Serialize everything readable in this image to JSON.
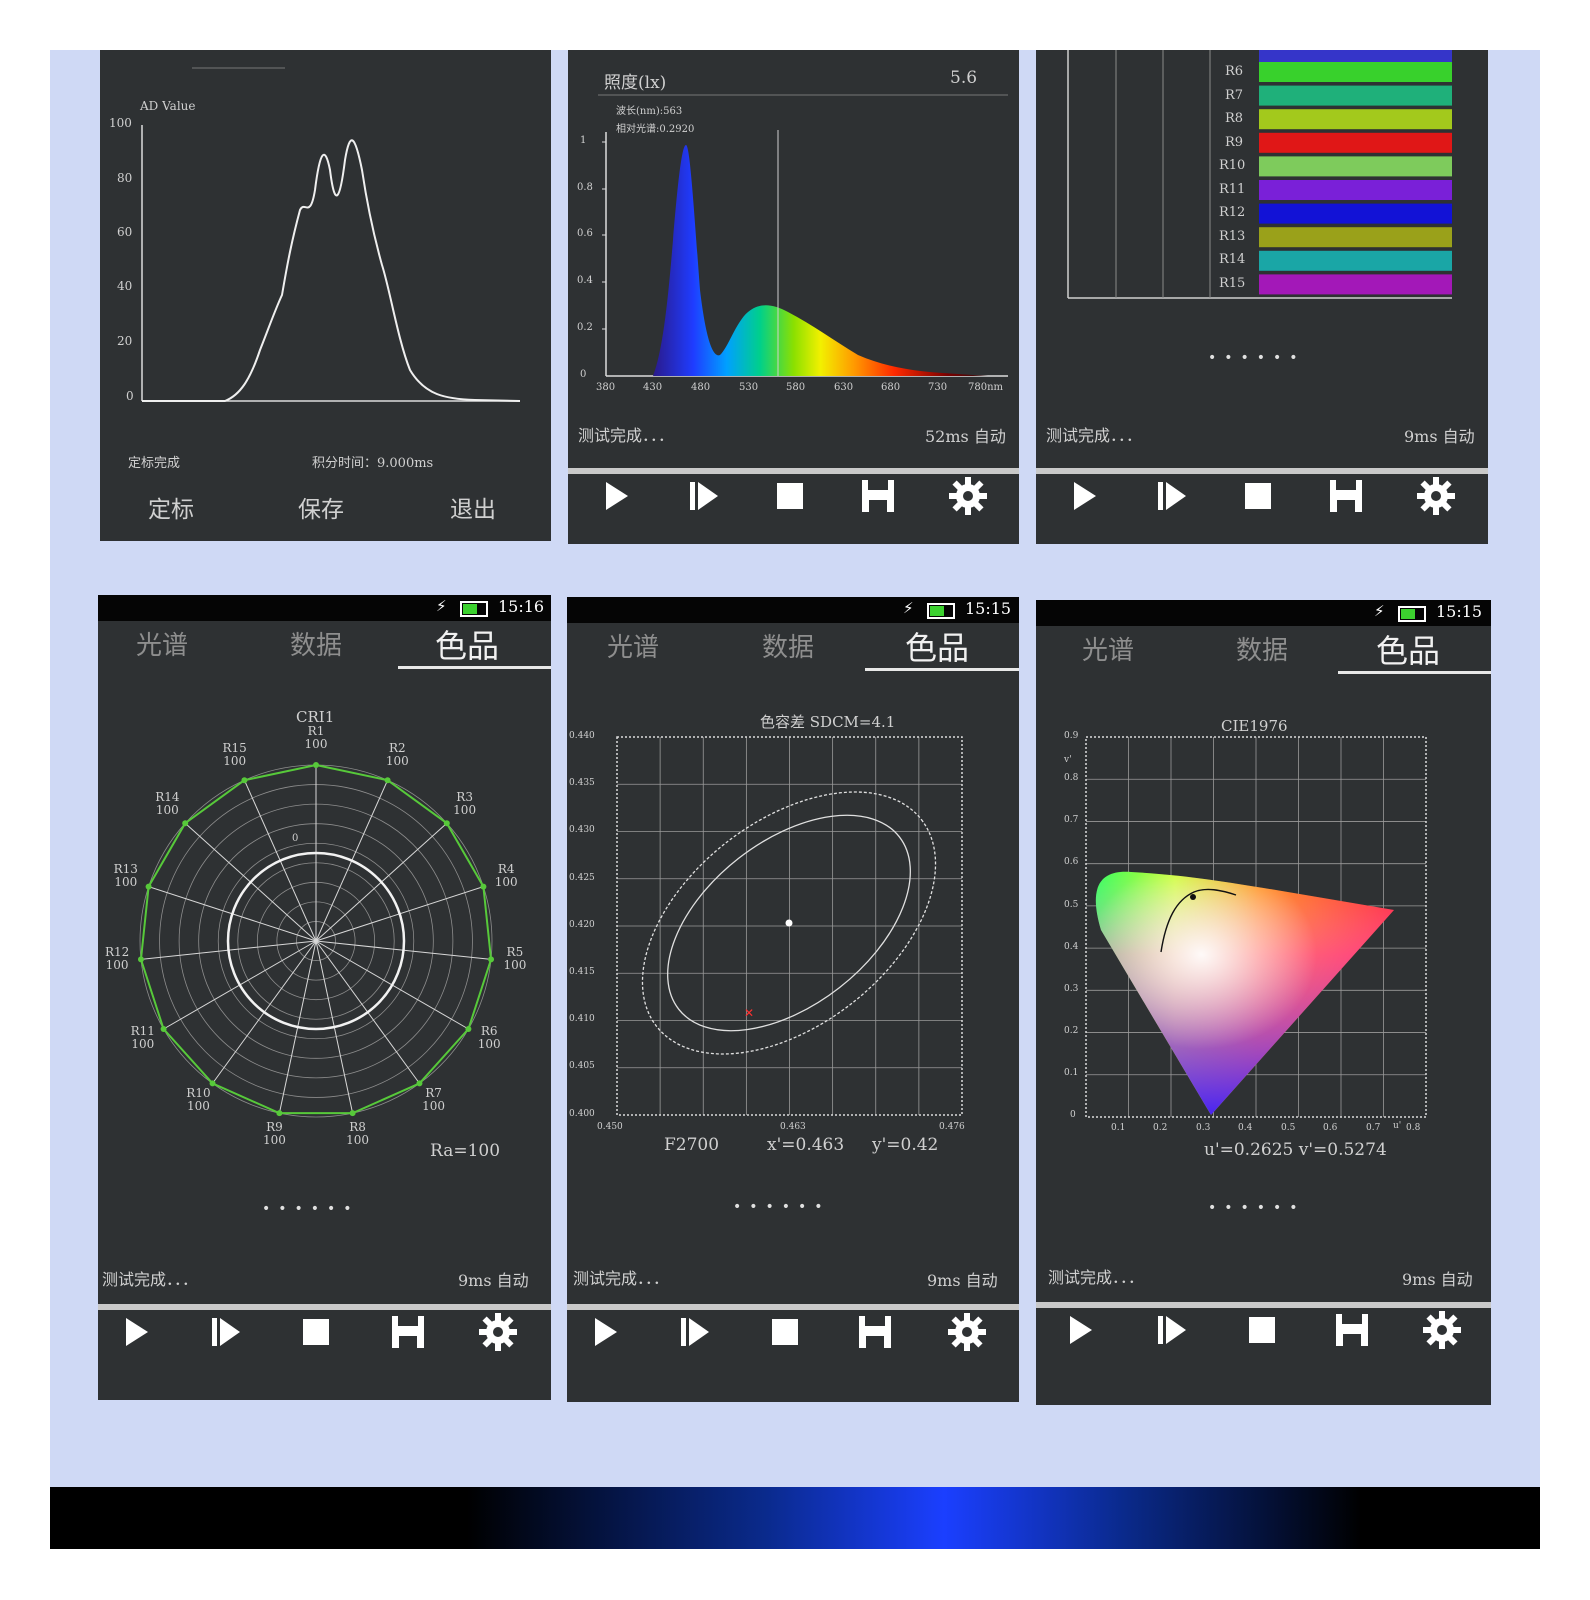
{
  "panels": {
    "p1": {
      "ylabel": "AD Value",
      "yticks": [
        "100",
        "80",
        "60",
        "40",
        "20",
        "0"
      ],
      "status": "定标完成",
      "integration": "积分时间：9.000ms",
      "buttons": [
        "定标",
        "保存",
        "退出"
      ]
    },
    "p2": {
      "lux_label": "照度(lx)",
      "lux_value": "5.6",
      "wavelength": "波长(nm):563",
      "relative": "相对光谱:0.2920",
      "yticks": [
        "1",
        "0.8",
        "0.6",
        "0.4",
        "0.2",
        "0"
      ],
      "xticks": [
        "380",
        "430",
        "480",
        "530",
        "580",
        "630",
        "680",
        "730",
        "780nm"
      ],
      "status": "测试完成．．．",
      "mode": "52ms 自动"
    },
    "p3": {
      "bar_labels": [
        "R6",
        "R7",
        "R8",
        "R9",
        "R10",
        "R11",
        "R12",
        "R13",
        "R14",
        "R15"
      ],
      "bar_colors": [
        "#38d12c",
        "#1fb07a",
        "#a3c91c",
        "#e01717",
        "#7ecb5c",
        "#7a20d8",
        "#1212d6",
        "#9aa11a",
        "#1aa6a6",
        "#a318b8"
      ],
      "status": "测试完成．．．",
      "mode": "9ms 自动"
    },
    "p4": {
      "time": "15:16",
      "tabs": [
        "光谱",
        "数据",
        "色品"
      ],
      "title": "CRI1",
      "center_label": "0",
      "r_labels": [
        {
          "n": "R1",
          "v": "100"
        },
        {
          "n": "R2",
          "v": "100"
        },
        {
          "n": "R3",
          "v": "100"
        },
        {
          "n": "R4",
          "v": "100"
        },
        {
          "n": "R5",
          "v": "100"
        },
        {
          "n": "R6",
          "v": "100"
        },
        {
          "n": "R7",
          "v": "100"
        },
        {
          "n": "R8",
          "v": "100"
        },
        {
          "n": "R9",
          "v": "100"
        },
        {
          "n": "R10",
          "v": "100"
        },
        {
          "n": "R11",
          "v": "100"
        },
        {
          "n": "R12",
          "v": "100"
        },
        {
          "n": "R13",
          "v": "100"
        },
        {
          "n": "R14",
          "v": "100"
        },
        {
          "n": "R15",
          "v": "100"
        }
      ],
      "ra": "Ra=100",
      "status": "测试完成．．．",
      "mode": "9ms 自动"
    },
    "p5": {
      "time": "15:15",
      "tabs": [
        "光谱",
        "数据",
        "色品"
      ],
      "title": "色容差  SDCM=4.1",
      "yticks": [
        "0.440",
        "0.435",
        "0.430",
        "0.425",
        "0.420",
        "0.415",
        "0.410",
        "0.405",
        "0.400"
      ],
      "xtick_left": "0.450",
      "xtick_mid": "0.463",
      "xtick_right": "0.476",
      "std": "F2700",
      "x_val": "x'=0.463",
      "y_val": "y'=0.42",
      "status": "测试完成．．．",
      "mode": "9ms 自动"
    },
    "p6": {
      "time": "15:15",
      "tabs": [
        "光谱",
        "数据",
        "色品"
      ],
      "title": "CIE1976",
      "yticks": [
        "0.9",
        "0.8",
        "0.7",
        "0.6",
        "0.5",
        "0.4",
        "0.3",
        "0.2",
        "0.1",
        "0"
      ],
      "xticks": [
        "0.1",
        "0.2",
        "0.3",
        "0.4",
        "0.5",
        "0.6",
        "0.7",
        "0.8"
      ],
      "yaxis": "v'",
      "xaxis": "u'",
      "uv": "u'=0.2625  v'=0.5274",
      "status": "测试完成．．．",
      "mode": "9ms 自动"
    }
  },
  "colors": {
    "panel_bg": "#2e3133",
    "page_bg": "#cfd9f5",
    "green": "#57c93a"
  },
  "icons": [
    "play-icon",
    "step-icon",
    "stop-icon",
    "save-icon",
    "settings-icon"
  ]
}
